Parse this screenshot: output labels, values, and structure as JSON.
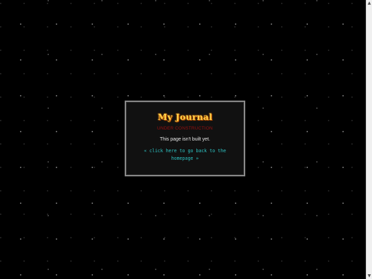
{
  "journal": {
    "title": "My Journal",
    "status": "UNDER CONSTRUCTION",
    "message": "This page isn't built yet.",
    "back_link": "« click here to go back to the homepage »"
  },
  "scrollbar": {
    "up_icon": "▲",
    "down_icon": "▼"
  },
  "colors": {
    "background": "#000000",
    "title": "#ffd24a",
    "status": "#9a1010",
    "link": "#2ec4c4",
    "border": "#8a8a8a"
  }
}
